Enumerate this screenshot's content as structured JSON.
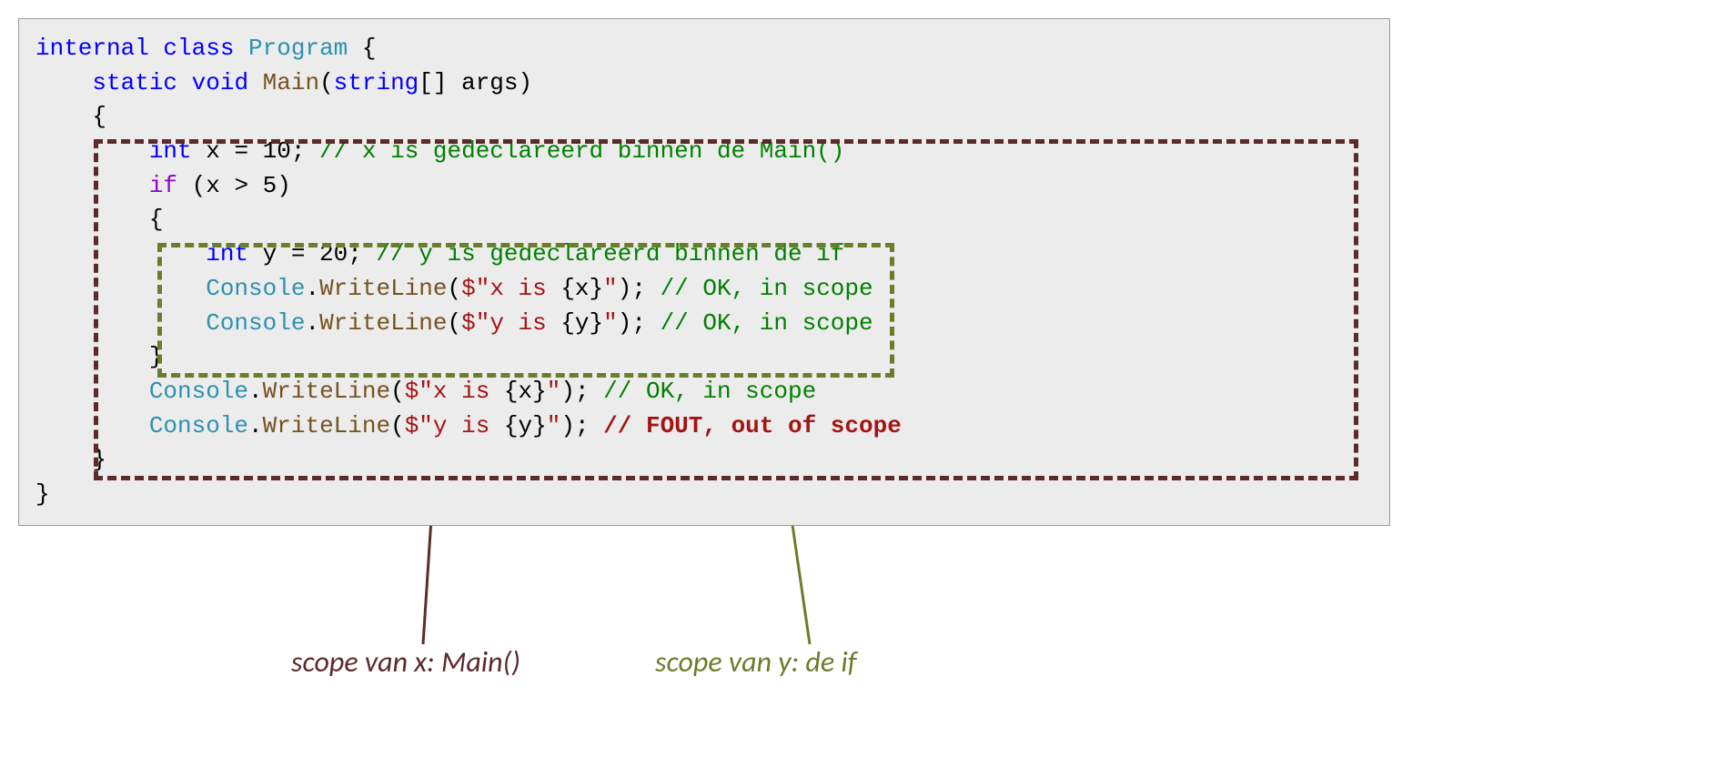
{
  "code": {
    "l1a": "internal",
    "l1b": " class",
    "l1c": " Program",
    "l1d": " {",
    "l2a": "    static",
    "l2b": " void",
    "l2c": " Main",
    "l2d": "(",
    "l2e": "string",
    "l2f": "[] args)",
    "l3": "    {",
    "l4a": "        int",
    "l4b": " x = 10; ",
    "l4c": "// x is gedeclareerd binnen de Main()",
    "l5a": "        if",
    "l5b": " (x > 5)",
    "l6": "        {",
    "l7a": "            int",
    "l7b": " y = 20; ",
    "l7c": "// y is gedeclareerd binnen de if",
    "l8a": "            Console",
    "l8b": ".",
    "l8c": "WriteLine",
    "l8d": "(",
    "l8e": "$\"x is ",
    "l8f": "{x}",
    "l8g": "\"",
    "l8h": "); ",
    "l8i": "// OK, in scope",
    "l9a": "            Console",
    "l9b": ".",
    "l9c": "WriteLine",
    "l9d": "(",
    "l9e": "$\"y is ",
    "l9f": "{y}",
    "l9g": "\"",
    "l9h": "); ",
    "l9i": "// OK, in scope",
    "l10": "        }",
    "l11a": "        Console",
    "l11b": ".",
    "l11c": "WriteLine",
    "l11d": "(",
    "l11e": "$\"x is ",
    "l11f": "{x}",
    "l11g": "\"",
    "l11h": "); ",
    "l11i": "// OK, in scope",
    "l12a": "        Console",
    "l12b": ".",
    "l12c": "WriteLine",
    "l12d": "(",
    "l12e": "$\"y is ",
    "l12f": "{y}",
    "l12g": "\"",
    "l12h": "); ",
    "l12i": "// FOUT, out of scope",
    "l13": "    }",
    "l14": "}"
  },
  "labels": {
    "scope_main": "scope van x: Main()",
    "scope_if": "scope van y: de if"
  }
}
